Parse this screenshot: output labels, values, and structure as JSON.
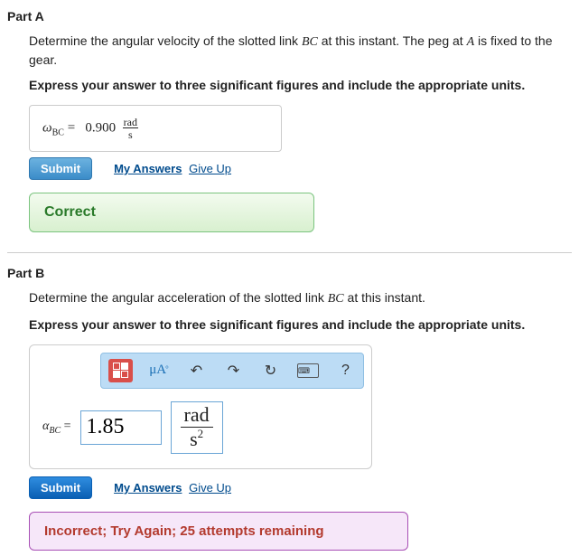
{
  "partA": {
    "title": "Part A",
    "prompt_pre": "Determine the angular velocity of the slotted link ",
    "prompt_link1": "BC",
    "prompt_mid": " at this instant. The peg at ",
    "prompt_link2": "A",
    "prompt_post": " is fixed to the gear.",
    "instruction": "Express your answer to three significant figures and include the appropriate units.",
    "var_symbol": "ω",
    "var_sub": "BC",
    "equals": " = ",
    "value": "0.900",
    "unit_num": "rad",
    "unit_den": "s",
    "submit": "Submit",
    "my_answers": "My Answers",
    "give_up": "Give Up",
    "feedback": "Correct"
  },
  "partB": {
    "title": "Part B",
    "prompt_pre": "Determine the angular acceleration of the slotted link ",
    "prompt_link1": "BC",
    "prompt_post": " at this instant.",
    "instruction": "Express your answer to three significant figures and include the appropriate units.",
    "toolbar": {
      "units_mu": "μ",
      "units_A": "A",
      "undo": "↶",
      "redo": "↷",
      "reset": "↻",
      "help": "?"
    },
    "var_symbol": "α",
    "var_sub": "BC",
    "equals": " = ",
    "value": "1.85",
    "unit_num": "rad",
    "unit_den_base": "s",
    "unit_den_exp": "2",
    "submit": "Submit",
    "my_answers": "My Answers",
    "give_up": "Give Up",
    "feedback": "Incorrect; Try Again; 25 attempts remaining"
  }
}
